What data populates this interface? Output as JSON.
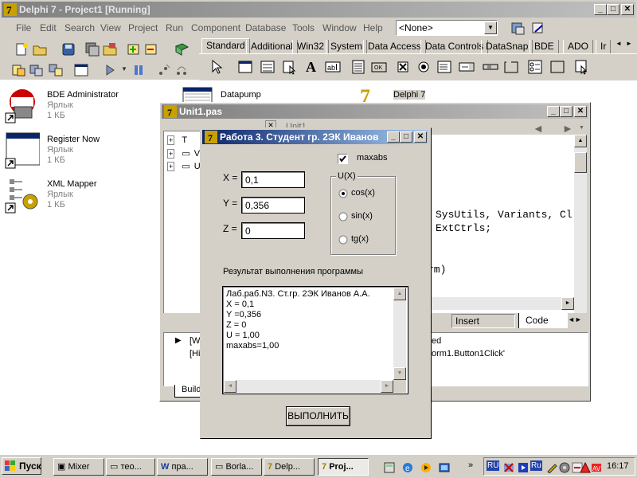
{
  "ide": {
    "title": "Delphi 7 - Project1 [Running]",
    "menu": [
      "File",
      "Edit",
      "Search",
      "View",
      "Project",
      "Run",
      "Component",
      "Database",
      "Tools",
      "Window",
      "Help"
    ],
    "combo_value": "<None>",
    "palette_tabs": [
      "Standard",
      "Additional",
      "Win32",
      "System",
      "Data Access",
      "Data Controls",
      "DataSnap",
      "BDE",
      "ADO",
      "Ir"
    ]
  },
  "desktop": {
    "items": [
      {
        "name": "BDE Administrator",
        "type": "Ярлык",
        "size": "1 КБ"
      },
      {
        "name": "Register Now",
        "type": "Ярлык",
        "size": "1 КБ"
      },
      {
        "name": "XML Mapper",
        "type": "Ярлык",
        "size": "1 КБ"
      },
      {
        "name": "Datapump"
      },
      {
        "name": "Delphi 7"
      }
    ]
  },
  "editor": {
    "title": "Unit1.pas",
    "tab": "Unit1",
    "tree_items": [
      "T",
      "V",
      "U"
    ],
    "code_lines": [
      "SysUtils, Variants, Cl",
      "ExtCtrls;",
      "rm)"
    ],
    "status_insert": "Insert",
    "tab_code": "Code",
    "messages": [
      "[W",
      "[Hi"
    ],
    "messages_right": [
      "ed",
      "orm1.Button1Click'"
    ],
    "build_tab": "Build"
  },
  "form": {
    "title": "Работа 3. Студент гр. 2ЭК Иванов",
    "x_label": "X =",
    "y_label": "Y =",
    "z_label": "Z =",
    "x_value": "0,1",
    "y_value": "0,356",
    "z_value": "0",
    "maxabs_label": "maxabs",
    "group_title": "U(X)",
    "radio_cos": "cos(x)",
    "radio_sin": "sin(x)",
    "radio_tg": "tg(x)",
    "result_label": "Результат выполнения программы",
    "result_lines": [
      "Лаб.раб.N3. Ст.гр. 2ЭК Иванов А.А.",
      "X = 0,1",
      "Y =0,356",
      "Z = 0",
      "U = 1,00",
      "maxabs=1,00"
    ],
    "run_button": "ВЫПОЛНИТЬ"
  },
  "taskbar": {
    "start": "Пуск",
    "tasks": [
      "Mixer",
      "тео...",
      "пра...",
      "Borla...",
      "Delp...",
      "Proj..."
    ],
    "lang": "RU",
    "lang2": "Ru",
    "time": "16:17"
  }
}
